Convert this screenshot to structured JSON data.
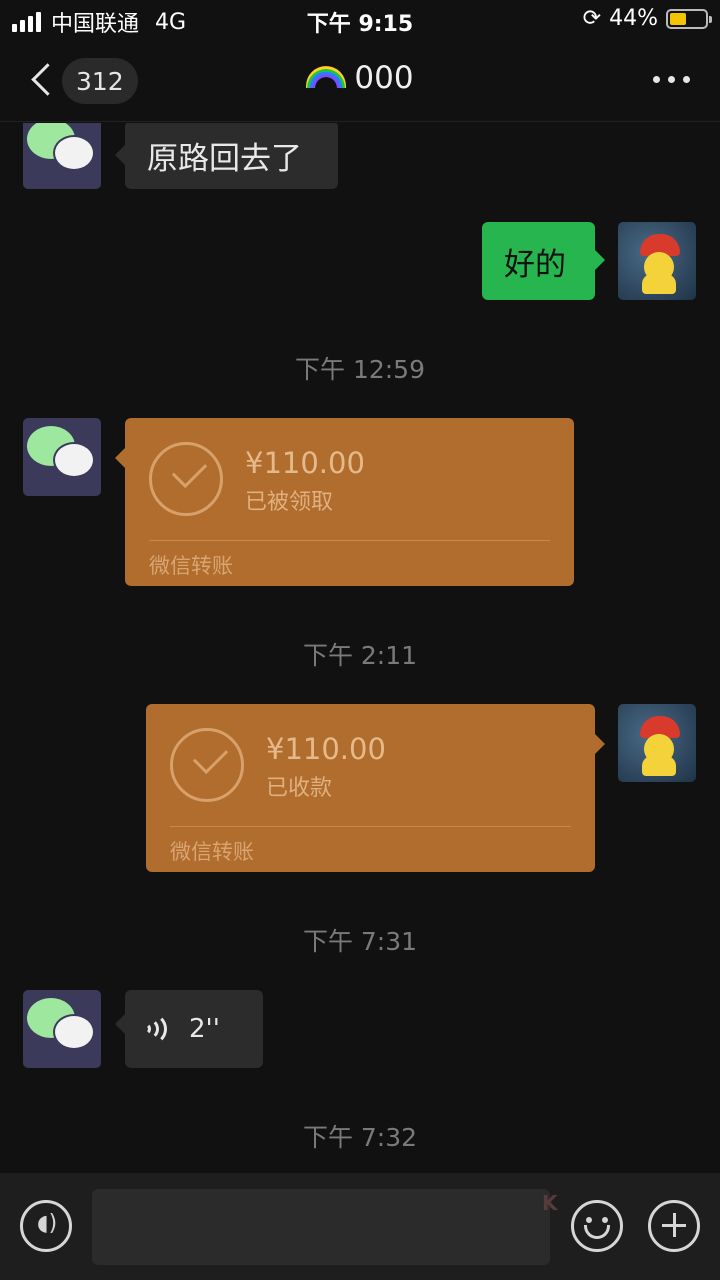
{
  "status_bar": {
    "carrier": "中国联通",
    "network": "4G",
    "time": "下午 9:15",
    "battery_percent": "44%",
    "battery_level": 0.44
  },
  "nav": {
    "unread_count": "312",
    "title": "000",
    "title_icon": "rainbow-emoji"
  },
  "messages": {
    "m1_text": "原路回去了",
    "m2_text": "好的",
    "time1": "下午 12:59",
    "transfer1": {
      "amount": "¥110.00",
      "status": "已被领取",
      "footer": "微信转账"
    },
    "time2": "下午 2:11",
    "transfer2": {
      "amount": "¥110.00",
      "status": "已收款",
      "footer": "微信转账"
    },
    "time3": "下午 7:31",
    "voice_duration": "2''",
    "time4": "下午 7:32"
  },
  "bottom": {
    "voice_icon": "voice-input-icon",
    "emoji_icon": "emoji-icon",
    "add_icon": "add-icon",
    "watermark": "卡农社区"
  },
  "colors": {
    "transfer_bg": "#b06d2d",
    "sent_bubble": "#27b54f",
    "received_bubble": "#2c2c2c",
    "background": "#111111"
  }
}
